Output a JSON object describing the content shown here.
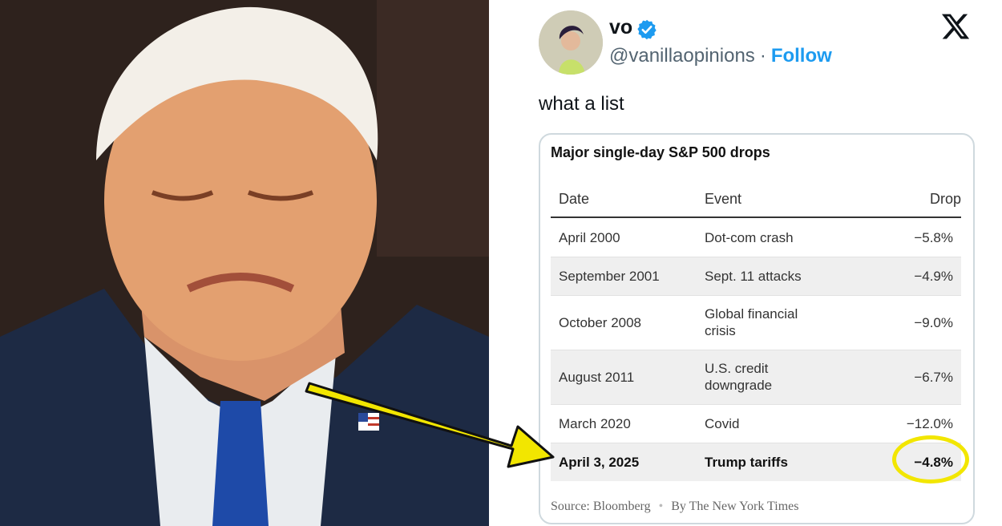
{
  "tweet": {
    "name": "vo",
    "handle": "@vanillaopinions",
    "separator": "·",
    "follow_label": "Follow",
    "text": "what a list"
  },
  "card": {
    "title": "Major single-day S&P 500 drops",
    "columns": [
      "Date",
      "Event",
      "Drop"
    ],
    "rows": [
      {
        "date": "April 2000",
        "event": "Dot-com crash",
        "drop": "−5.8%"
      },
      {
        "date": "September 2001",
        "event": "Sept. 11 attacks",
        "drop": "−4.9%"
      },
      {
        "date": "October 2008",
        "event": "Global financial crisis",
        "drop": "−9.0%"
      },
      {
        "date": "August 2011",
        "event": "U.S. credit downgrade",
        "drop": "−6.7%"
      },
      {
        "date": "March 2020",
        "event": "Covid",
        "drop": "−12.0%"
      },
      {
        "date": "April 3, 2025",
        "event": "Trump tariffs",
        "drop": "−4.8%"
      }
    ],
    "source": "Source: Bloomberg",
    "byline": "By The New York Times"
  },
  "colors": {
    "highlight": "#f2e600",
    "verified": "#1d9bf0",
    "follow": "#1d9bf0"
  },
  "icons": {
    "verified": "verified-badge-icon",
    "x_logo": "x-logo-icon",
    "arrow": "yellow-arrow-icon"
  }
}
